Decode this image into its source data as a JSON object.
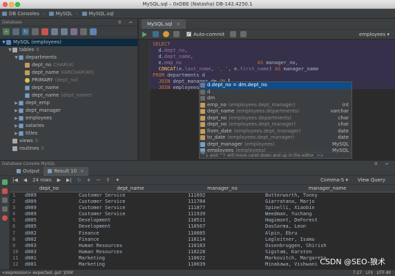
{
  "window": {
    "title": "MySQL.sql – 0xDBE (Natasha) DB-142.4250.1"
  },
  "breadcrumb": [
    "DB Consoles",
    "MySQL",
    "MySQL.sql"
  ],
  "database_panel": {
    "title": "Database",
    "tree": [
      {
        "label": "MySQL (employees)",
        "depth": 0,
        "icon": "db",
        "arrow": "▼",
        "selected": true,
        "hint": ""
      },
      {
        "label": "tables",
        "depth": 1,
        "icon": "folder",
        "arrow": "▼",
        "hint": "6"
      },
      {
        "label": "departments",
        "depth": 2,
        "icon": "table",
        "arrow": "▼",
        "hint": ""
      },
      {
        "label": "dept_no",
        "depth": 3,
        "icon": "col",
        "arrow": "",
        "hint": "CHAR(4)"
      },
      {
        "label": "dept_name",
        "depth": 3,
        "icon": "col",
        "arrow": "",
        "hint": "VARCHAR(40)"
      },
      {
        "label": "PRIMARY",
        "depth": 3,
        "icon": "key",
        "arrow": "",
        "hint": "(dept_no)"
      },
      {
        "label": "dept_name",
        "depth": 3,
        "icon": "table",
        "arrow": "",
        "hint": ""
      },
      {
        "label": "dept_name",
        "depth": 3,
        "icon": "table",
        "arrow": "",
        "hint": "(dept_name)"
      },
      {
        "label": "dept_emp",
        "depth": 2,
        "icon": "table",
        "arrow": "▶",
        "hint": ""
      },
      {
        "label": "dept_manager",
        "depth": 2,
        "icon": "table",
        "arrow": "▶",
        "hint": ""
      },
      {
        "label": "employees",
        "depth": 2,
        "icon": "table",
        "arrow": "▶",
        "hint": ""
      },
      {
        "label": "salaries",
        "depth": 2,
        "icon": "table",
        "arrow": "▶",
        "hint": ""
      },
      {
        "label": "titles",
        "depth": 2,
        "icon": "table",
        "arrow": "▶",
        "hint": ""
      },
      {
        "label": "views",
        "depth": 1,
        "icon": "folder",
        "arrow": "",
        "hint": "0"
      },
      {
        "label": "routines",
        "depth": 1,
        "icon": "folder",
        "arrow": "",
        "hint": "0"
      }
    ]
  },
  "editor": {
    "tab": "MySQL.sql",
    "autocommit_label": "Auto-commit",
    "schema": "employees",
    "lines": [
      [
        {
          "c": "kw",
          "t": "SELECT"
        }
      ],
      [
        {
          "c": "plain",
          "t": "  d."
        },
        {
          "c": "fld",
          "t": "dept_no"
        },
        {
          "c": "plain",
          "t": ","
        }
      ],
      [
        {
          "c": "plain",
          "t": "  d."
        },
        {
          "c": "fld",
          "t": "dept_name"
        },
        {
          "c": "plain",
          "t": ","
        }
      ],
      [
        {
          "c": "plain",
          "t": "  e."
        },
        {
          "c": "fld",
          "t": "emp_no"
        },
        {
          "c": "plain",
          "t": "                          "
        },
        {
          "c": "kw",
          "t": "AS"
        },
        {
          "c": "plain",
          "t": " manager_no,"
        }
      ],
      [
        {
          "c": "plain",
          "t": "  "
        },
        {
          "c": "fn",
          "t": "CONCAT"
        },
        {
          "c": "plain",
          "t": "(e."
        },
        {
          "c": "fld",
          "t": "last_name"
        },
        {
          "c": "plain",
          "t": ", "
        },
        {
          "c": "str",
          "t": "', '"
        },
        {
          "c": "plain",
          "t": ", e."
        },
        {
          "c": "fld",
          "t": "first_name"
        },
        {
          "c": "plain",
          "t": ") "
        },
        {
          "c": "kw",
          "t": "AS"
        },
        {
          "c": "plain",
          "t": " manager_name"
        }
      ],
      [
        {
          "c": "kw",
          "t": "FROM"
        },
        {
          "c": "plain",
          "t": " departments d"
        }
      ],
      [
        {
          "c": "plain",
          "t": "  "
        },
        {
          "c": "kw",
          "t": "JOIN"
        },
        {
          "c": "plain",
          "t": " dept_manager dm "
        },
        {
          "c": "kw",
          "t": "ON"
        },
        {
          "c": "plain",
          "t": " "
        }
      ],
      [
        {
          "c": "plain",
          "t": "  "
        },
        {
          "c": "kw",
          "t": "JOIN"
        },
        {
          "c": "plain",
          "t": " employees "
        }
      ]
    ]
  },
  "completion": {
    "items": [
      {
        "icon": "join",
        "label": "d.dept_no = dm.dept_no",
        "hint": "",
        "type": "",
        "selected": true
      },
      {
        "icon": "alias",
        "label": "d",
        "hint": "",
        "type": ""
      },
      {
        "icon": "alias",
        "label": "dm",
        "hint": "",
        "type": ""
      },
      {
        "icon": "col",
        "label": "emp_no",
        "hint": "(employees.dept_manager)",
        "type": "int"
      },
      {
        "icon": "col",
        "label": "dept_name",
        "hint": "(employees.departments)",
        "type": "varchar"
      },
      {
        "icon": "col",
        "label": "dept_no",
        "hint": "(employees.departments)",
        "type": "char"
      },
      {
        "icon": "col",
        "label": "dept_no",
        "hint": "(employees.dept_manager)",
        "type": "char"
      },
      {
        "icon": "col",
        "label": "from_date",
        "hint": "(employees.dept_manager)",
        "type": "date"
      },
      {
        "icon": "col",
        "label": "to_date",
        "hint": "(employees.dept_manager)",
        "type": "date"
      },
      {
        "icon": "table",
        "label": "dept_manager",
        "hint": "(employees)",
        "type": "MySQL"
      },
      {
        "icon": "table",
        "label": "employees",
        "hint": "(employees)",
        "type": "MySQL"
      }
    ],
    "footer": "^↓ and ^↑ will move caret down and up in the editor",
    "footer_link": ">>"
  },
  "console": {
    "title": "Database Console MySQL",
    "tabs": [
      "Output",
      "Result 10"
    ],
    "rows_label": "24 rows",
    "separator": "Comma-S",
    "view_query": "View Query",
    "columns": [
      "dept_no",
      "dept_name",
      "manager_no",
      "manager_name"
    ],
    "rows": [
      [
        "1",
        "d009",
        "Customer Service",
        "111692",
        "Butterworth, Tonny"
      ],
      [
        "2",
        "d009",
        "Customer Service",
        "111784",
        "Giarratana, Marjo"
      ],
      [
        "3",
        "d009",
        "Customer Service",
        "111877",
        "Spinelli, Xiaobin"
      ],
      [
        "4",
        "d009",
        "Customer Service",
        "111939",
        "Weedman, Yuchang"
      ],
      [
        "5",
        "d005",
        "Development",
        "110511",
        "Hagimont, DeForest"
      ],
      [
        "6",
        "d005",
        "Development",
        "110567",
        "DasSarma, Leon"
      ],
      [
        "7",
        "d002",
        "Finance",
        "110085",
        "Alpin, Ebru"
      ],
      [
        "8",
        "d002",
        "Finance",
        "110114",
        "Legleitner, Isamu"
      ],
      [
        "9",
        "d003",
        "Human Resources",
        "110183",
        "Ossenbruggen, Shirish"
      ],
      [
        "10",
        "d003",
        "Human Resources",
        "110228",
        "Sigstam, Karsten"
      ],
      [
        "11",
        "d001",
        "Marketing",
        "110022",
        "Markovitch, Margareta"
      ],
      [
        "12",
        "d001",
        "Marketing",
        "110039",
        "Minakawa, Vishwani"
      ]
    ]
  },
  "status": {
    "message": "<expression> expected, got 'JOIN'",
    "position": "7:27",
    "line_sep": "LF‡",
    "encoding": "UTF-8‡"
  },
  "watermark": "CSDN @SEO-狼术",
  "colors": {
    "background": "#2b2b2b",
    "panel": "#3c3f41",
    "selection": "#0e4d89",
    "keyword": "#cc7832"
  }
}
